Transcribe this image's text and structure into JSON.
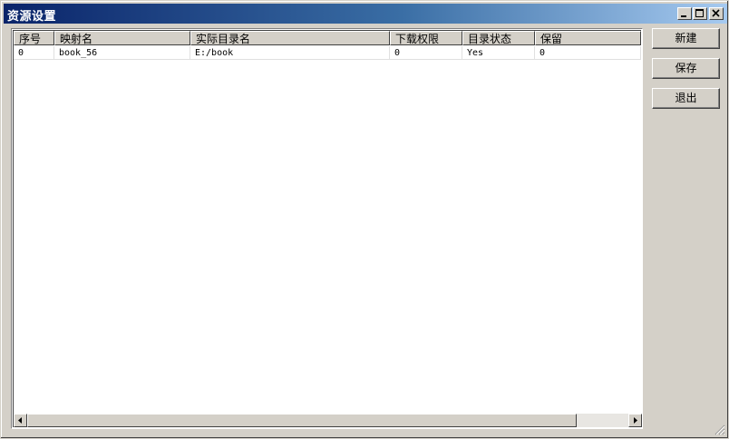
{
  "window": {
    "title": "资源设置"
  },
  "table": {
    "columns": [
      "序号",
      "映射名",
      "实际目录名",
      "下载权限",
      "目录状态",
      "保留"
    ],
    "rows": [
      [
        "0",
        "book_56",
        "E:/book",
        "0",
        "Yes",
        "0"
      ]
    ]
  },
  "buttons": {
    "new": "新建",
    "save": "保存",
    "exit": "退出"
  },
  "icons": {
    "minimize": "minimize-icon",
    "maximize": "maximize-icon",
    "close": "close-icon"
  }
}
